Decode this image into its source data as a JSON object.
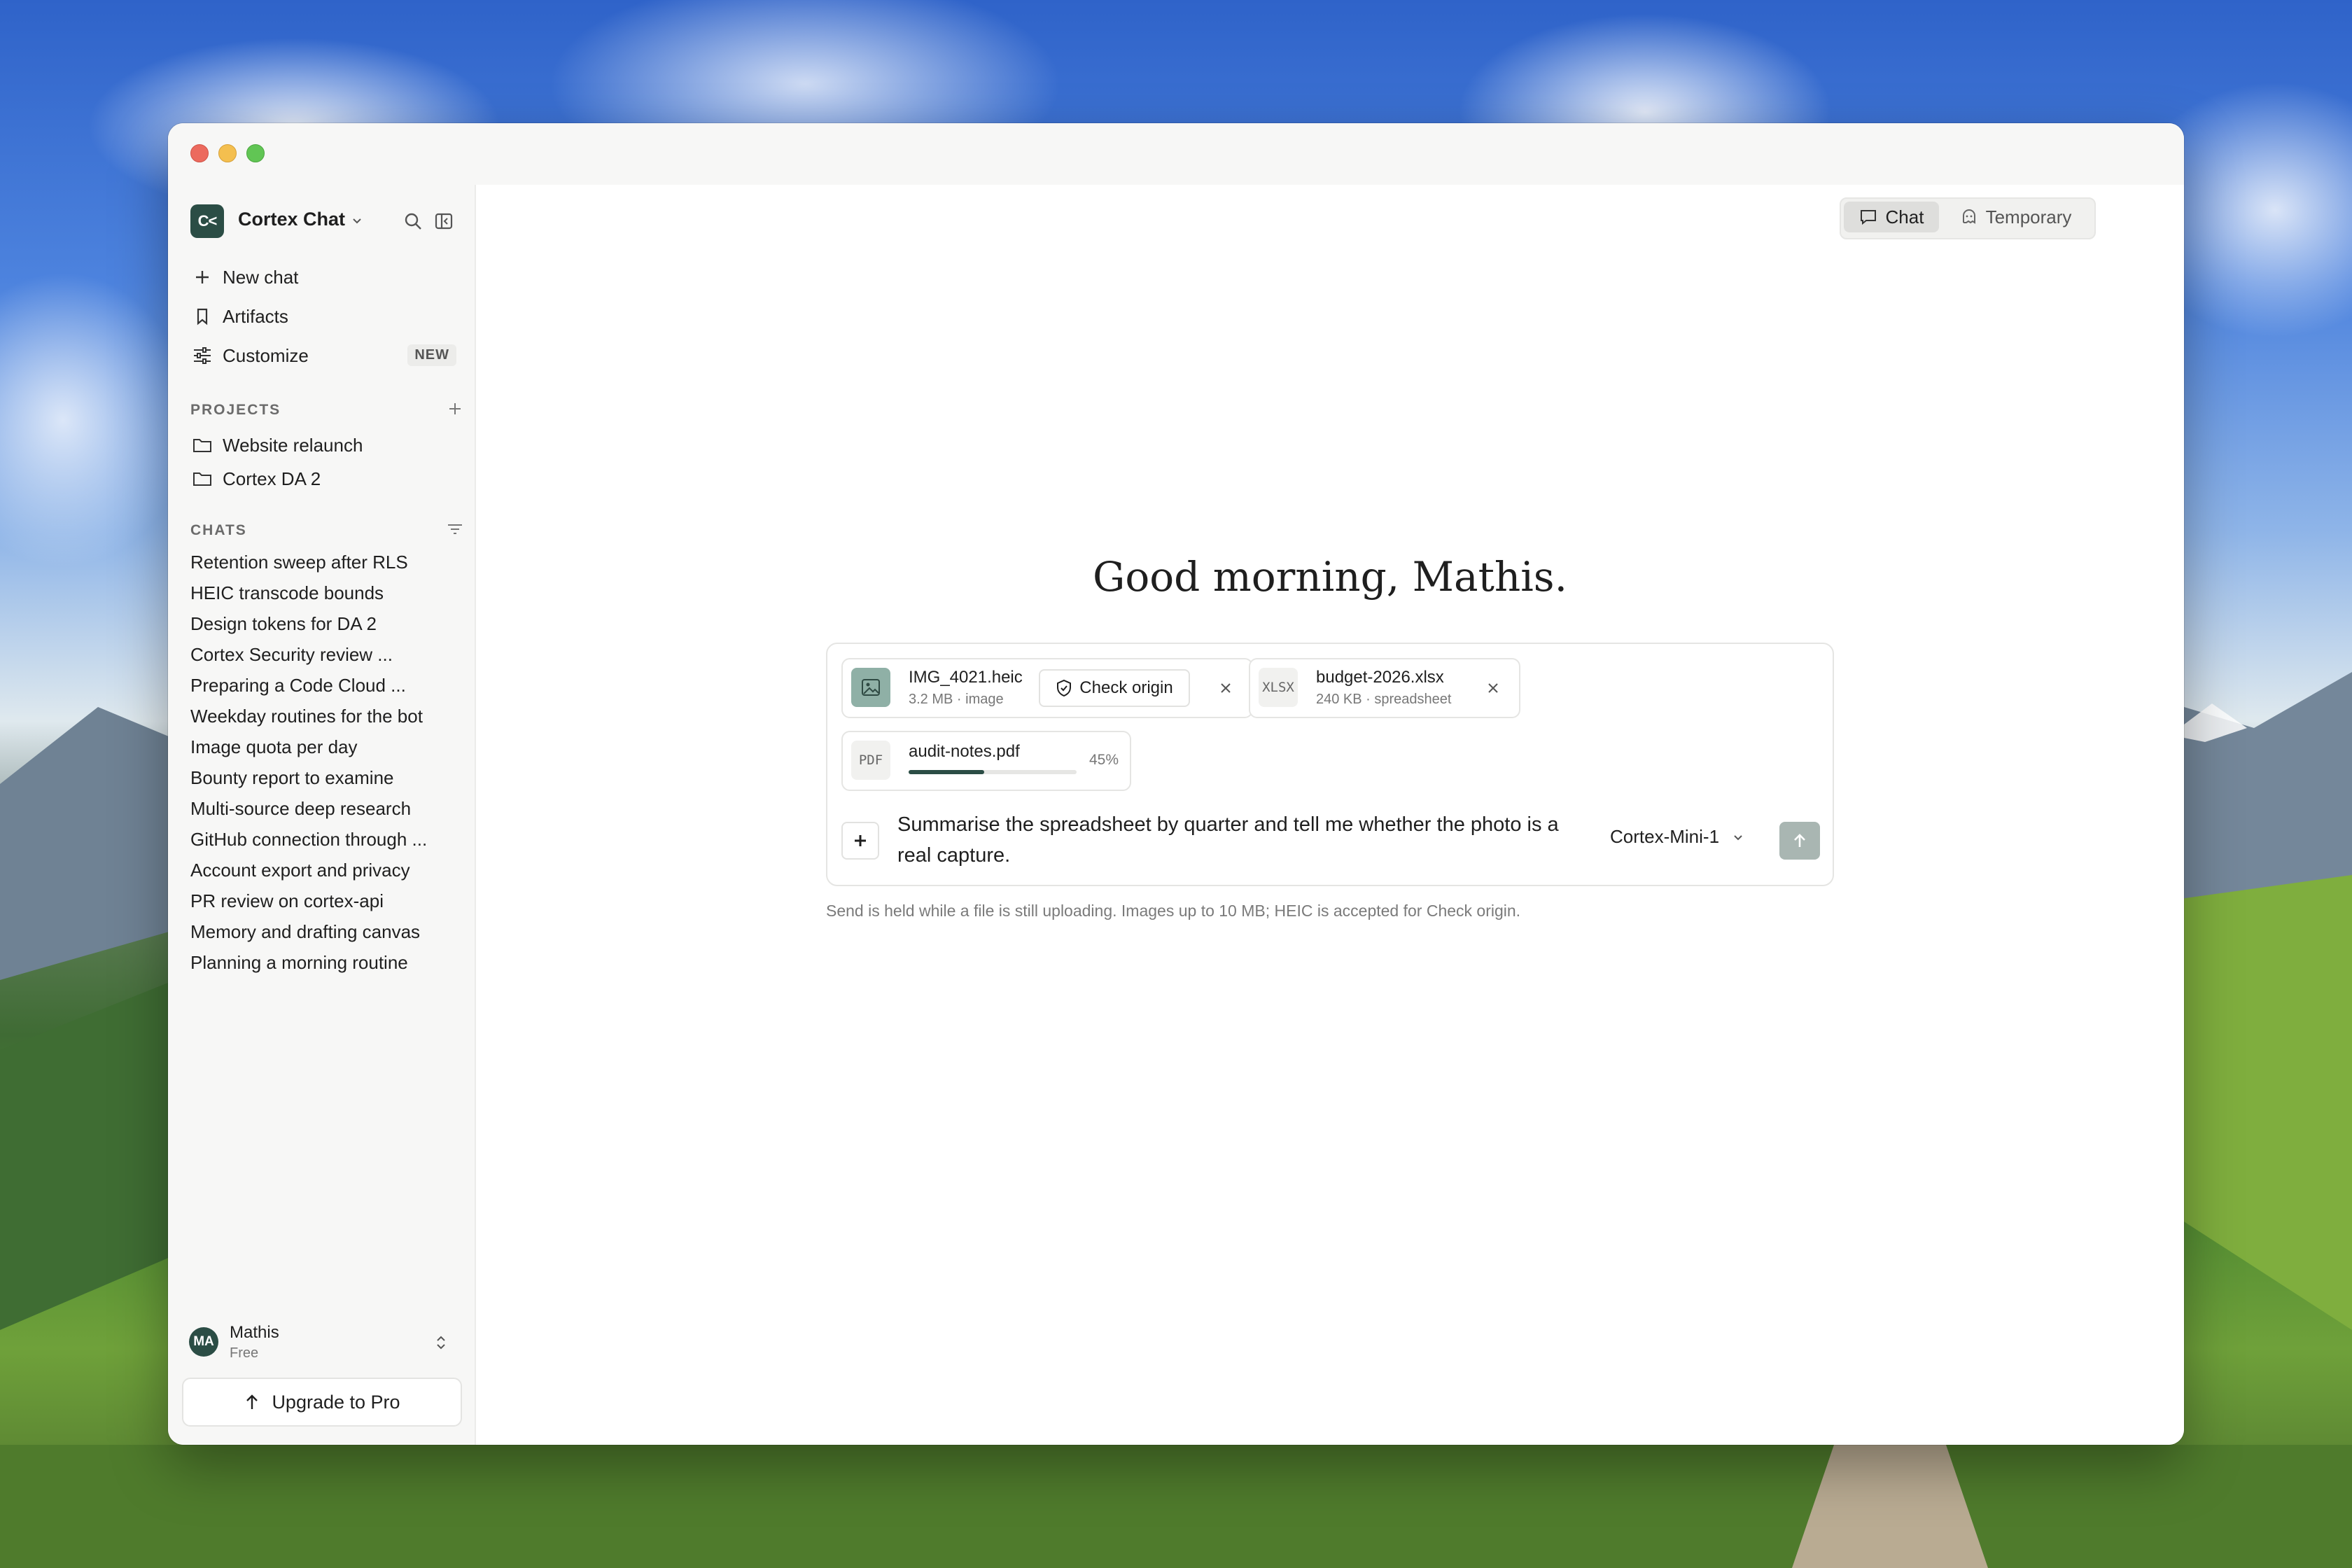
{
  "app": {
    "name": "Cortex Chat",
    "logo_text": "C<"
  },
  "sidebar": {
    "nav": [
      {
        "label": "New chat",
        "icon": "plus-icon"
      },
      {
        "label": "Artifacts",
        "icon": "bookmark-icon"
      },
      {
        "label": "Customize",
        "icon": "sliders-icon",
        "badge": "NEW"
      }
    ],
    "projects_title": "PROJECTS",
    "projects": [
      "Website relaunch",
      "Cortex DA 2"
    ],
    "chats_title": "CHATS",
    "chats": [
      "Retention sweep after RLS",
      "HEIC transcode bounds",
      "Design tokens for DA 2",
      "Cortex Security review ...",
      "Preparing a Code Cloud ...",
      "Weekday routines for the bot",
      "Image quota per day",
      "Bounty report to examine",
      "Multi-source deep research",
      "GitHub connection through ...",
      "Account export and privacy",
      "PR review on cortex-api",
      "Memory and drafting canvas",
      "Planning a morning routine"
    ],
    "user": {
      "initials": "MA",
      "name": "Mathis",
      "plan": "Free"
    },
    "upgrade_label": "Upgrade to Pro"
  },
  "header": {
    "mode_chat": "Chat",
    "mode_temporary": "Temporary"
  },
  "main": {
    "greeting": "Good morning, Mathis.",
    "attachments": [
      {
        "name": "IMG_4021.heic",
        "meta": "3.2 MB · image",
        "action": "Check origin"
      },
      {
        "name": "budget-2026.xlsx",
        "meta": "240 KB · spreadsheet",
        "type_label": "XLSX"
      },
      {
        "name": "audit-notes.pdf",
        "type_label": "PDF",
        "progress": 45,
        "progress_text": "45%"
      }
    ],
    "prompt": "Summarise the spreadsheet by quarter and tell me whether the photo is a real capture.",
    "model": "Cortex-Mini-1",
    "hint": "Send is held while a file is still uploading. Images up to 10 MB; HEIC is accepted for Check origin."
  },
  "colors": {
    "accent": "#2b4d45",
    "send_disabled": "#a9b6b2"
  }
}
